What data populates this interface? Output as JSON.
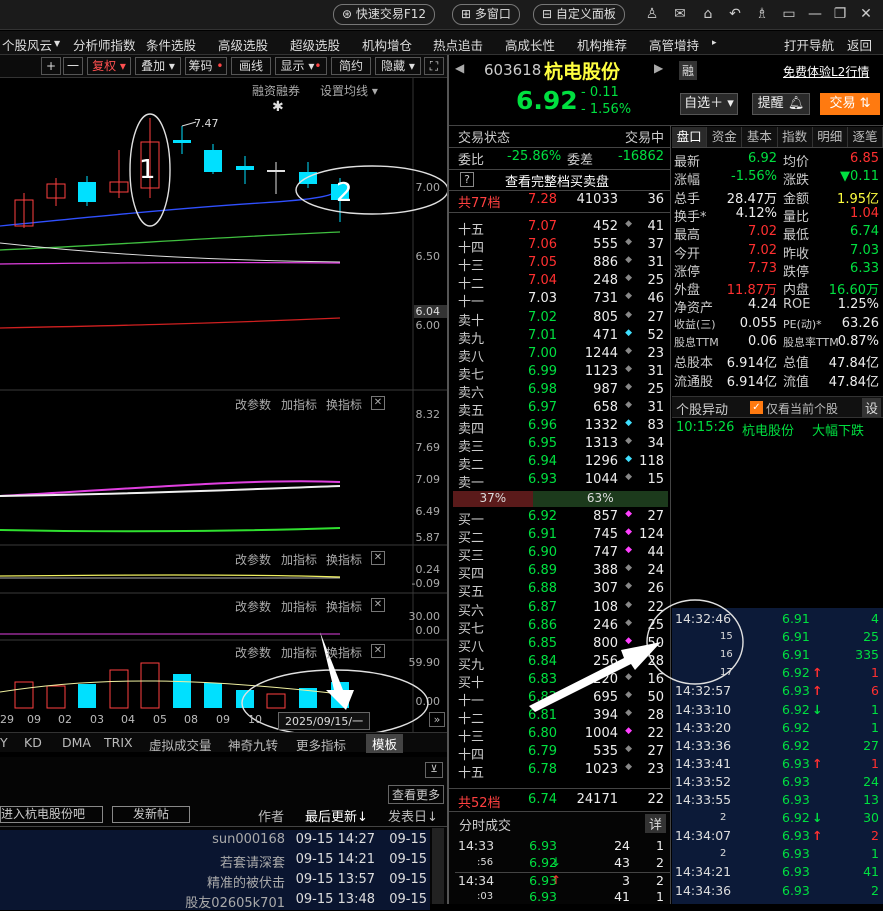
{
  "topbar": {
    "quick_trade": "快速交易F12",
    "multi_window": "多窗口",
    "custom_panel": "自定义面板"
  },
  "menu": {
    "items": [
      "个股风云",
      "分析师指数",
      "条件选股",
      "高级选股",
      "超级选股",
      "机构增仓",
      "热点追击",
      "高成长性",
      "机构推荐",
      "高管增持"
    ],
    "open_nav": "打开导航",
    "back": "返回"
  },
  "chart_toolbar": {
    "plus": "+",
    "minus": "一",
    "fuquan": "复权",
    "overlay": "叠加",
    "chips": "筹码",
    "draw": "画线",
    "display": "显示",
    "simple": "简约",
    "hide": "隐藏",
    "margin": "融资融券",
    "ma_settings": "设置均线"
  },
  "kline": {
    "high_label": "7.47",
    "ann1": "1",
    "ann2": "2",
    "axis": [
      "7.00",
      "6.50",
      "6.04",
      "6.00"
    ]
  },
  "indicator1": {
    "btns": [
      "改参数",
      "加指标",
      "换指标"
    ],
    "axis": [
      "8.32",
      "7.69",
      "7.09",
      "6.49",
      "5.87"
    ]
  },
  "indicator2": {
    "btns": [
      "改参数",
      "加指标",
      "换指标"
    ],
    "axis": [
      "0.24",
      "-0.09"
    ]
  },
  "indicator3": {
    "btns": [
      "改参数",
      "加指标",
      "换指标"
    ],
    "axis": [
      "30.00",
      "0.00"
    ]
  },
  "indicator4": {
    "btns": [
      "改参数",
      "加指标",
      "换指标"
    ],
    "axis": [
      "59.90",
      "0.00"
    ]
  },
  "dates": [
    "29",
    "09",
    "02",
    "03",
    "04",
    "05",
    "08",
    "09",
    "10"
  ],
  "current_date": "2025/09/15/一",
  "tabs": [
    "Y",
    "KD",
    "DMA",
    "TRIX",
    "虚拟成交量",
    "神奇九转",
    "更多指标",
    "模板"
  ],
  "news": {
    "more": "查看更多",
    "post_hint": "进入杭电股份吧",
    "post_btn": "发新帖",
    "col_author": "作者",
    "col_update": "最后更新↓",
    "col_date": "发表日↓",
    "rows": [
      {
        "author": "sun000168",
        "update": "09-15 14:27",
        "date": "09-15"
      },
      {
        "author": "若套请深套",
        "update": "09-15 14:21",
        "date": "09-15"
      },
      {
        "author": "精准的被伏击",
        "update": "09-15 13:57",
        "date": "09-15"
      },
      {
        "author": "股友02605k701",
        "update": "09-15 13:48",
        "date": "09-15"
      }
    ]
  },
  "stock": {
    "code": "603618",
    "name": "杭电股份",
    "rong": "融",
    "free_l2": "免费体验L2行情",
    "price": "6.92",
    "change": "- 0.11",
    "pct": "- 1.56%",
    "zixuan": "自选＋",
    "remind": "提醒",
    "trade": "交易"
  },
  "orderbook": {
    "title": "交易状态",
    "status": "交易中",
    "weibi_label": "委比",
    "weibi": "-25.86%",
    "weicha_label": "委差",
    "weicha": "-16862",
    "view_full": "查看完整档买卖盘",
    "help": "?",
    "top_total": {
      "label": "共77档",
      "price": "7.28",
      "vol": "41033",
      "cnt": "36"
    },
    "sells": [
      [
        "十五",
        "7.07",
        "452",
        "41"
      ],
      [
        "十四",
        "7.06",
        "555",
        "37"
      ],
      [
        "十三",
        "7.05",
        "886",
        "31"
      ],
      [
        "十二",
        "7.04",
        "248",
        "25"
      ],
      [
        "十一",
        "7.03",
        "731",
        "46"
      ],
      [
        "卖十",
        "7.02",
        "805",
        "27"
      ],
      [
        "卖九",
        "7.01",
        "471",
        "52"
      ],
      [
        "卖八",
        "7.00",
        "1244",
        "23"
      ],
      [
        "卖七",
        "6.99",
        "1123",
        "31"
      ],
      [
        "卖六",
        "6.98",
        "987",
        "25"
      ],
      [
        "卖五",
        "6.97",
        "658",
        "31"
      ],
      [
        "卖四",
        "6.96",
        "1332",
        "83"
      ],
      [
        "卖三",
        "6.95",
        "1313",
        "34"
      ],
      [
        "卖二",
        "6.94",
        "1296",
        "118"
      ],
      [
        "卖一",
        "6.93",
        "1044",
        "15"
      ]
    ],
    "ratio_sell": "37%",
    "ratio_buy": "63%",
    "buys": [
      [
        "买一",
        "6.92",
        "857",
        "27"
      ],
      [
        "买二",
        "6.91",
        "745",
        "124"
      ],
      [
        "买三",
        "6.90",
        "747",
        "44"
      ],
      [
        "买四",
        "6.89",
        "388",
        "24"
      ],
      [
        "买五",
        "6.88",
        "307",
        "26"
      ],
      [
        "买六",
        "6.87",
        "108",
        "22"
      ],
      [
        "买七",
        "6.86",
        "246",
        "25"
      ],
      [
        "买八",
        "6.85",
        "800",
        "50"
      ],
      [
        "买九",
        "6.84",
        "256",
        "28"
      ],
      [
        "买十",
        "6.83",
        "220",
        "16"
      ],
      [
        "十一",
        "6.82",
        "695",
        "50"
      ],
      [
        "十二",
        "6.81",
        "394",
        "28"
      ],
      [
        "十三",
        "6.80",
        "1004",
        "22"
      ],
      [
        "十四",
        "6.79",
        "535",
        "27"
      ],
      [
        "十五",
        "6.78",
        "1023",
        "23"
      ]
    ],
    "bottom_total": {
      "label": "共52档",
      "price": "6.74",
      "vol": "24171",
      "cnt": "22"
    }
  },
  "fenshi": {
    "title": "分时成交",
    "detail": "详",
    "rows": [
      [
        "14:33",
        "6.93",
        "24",
        "1"
      ],
      [
        ":56",
        "6.92",
        "43",
        "2"
      ],
      [
        "14:34",
        "6.93",
        "3",
        "2"
      ],
      [
        ":03",
        "6.93",
        "41",
        "1"
      ]
    ]
  },
  "quote_tabs": [
    "盘口",
    "资金",
    "基本",
    "指数",
    "明细",
    "逐笔"
  ],
  "quote": [
    [
      "最新",
      "6.92",
      "均价",
      "6.85"
    ],
    [
      "涨幅",
      "-1.56%",
      "涨跌",
      "▼0.11"
    ],
    [
      "总手",
      "28.47万",
      "金额",
      "1.95亿"
    ],
    [
      "换手*",
      "4.12%",
      "量比",
      "1.04"
    ],
    [
      "最高",
      "7.02",
      "最低",
      "6.74"
    ],
    [
      "今开",
      "7.02",
      "昨收",
      "7.03"
    ],
    [
      "涨停",
      "7.73",
      "跌停",
      "6.33"
    ],
    [
      "外盘",
      "11.87万",
      "内盘",
      "16.60万"
    ],
    [
      "净资产",
      "4.24",
      "ROE",
      "1.25%"
    ],
    [
      "收益(三)",
      "0.055",
      "PE(动)*",
      "63.26"
    ],
    [
      "股息TTM",
      "0.06",
      "股息率TTM",
      "0.87%"
    ],
    [
      "总股本",
      "6.914亿",
      "总值",
      "47.84亿"
    ],
    [
      "流通股",
      "6.914亿",
      "流值",
      "47.84亿"
    ]
  ],
  "anomaly": {
    "title": "个股异动",
    "only_current": "仅看当前个股",
    "settings": "设",
    "time": "10:15:26",
    "name": "杭电股份",
    "event": "大幅下跌"
  },
  "ticks": [
    [
      "14:32:46",
      "6.91",
      "4",
      ""
    ],
    [
      "15",
      "6.91",
      "25",
      ""
    ],
    [
      "16",
      "6.91",
      "335",
      ""
    ],
    [
      "17",
      "6.92",
      "1",
      "up"
    ],
    [
      "14:32:57",
      "6.93",
      "6",
      "up"
    ],
    [
      "14:33:10",
      "6.92",
      "1",
      "down"
    ],
    [
      "14:33:20",
      "6.92",
      "1",
      ""
    ],
    [
      "14:33:36",
      "6.92",
      "27",
      ""
    ],
    [
      "14:33:41",
      "6.93",
      "1",
      "up"
    ],
    [
      "14:33:52",
      "6.93",
      "24",
      ""
    ],
    [
      "14:33:55",
      "6.93",
      "13",
      ""
    ],
    [
      "2",
      "6.92",
      "30",
      "down"
    ],
    [
      "14:34:07",
      "6.93",
      "2",
      "up"
    ],
    [
      "2",
      "6.93",
      "1",
      ""
    ],
    [
      "14:34:21",
      "6.93",
      "41",
      ""
    ],
    [
      "14:34:36",
      "6.93",
      "2",
      ""
    ]
  ]
}
